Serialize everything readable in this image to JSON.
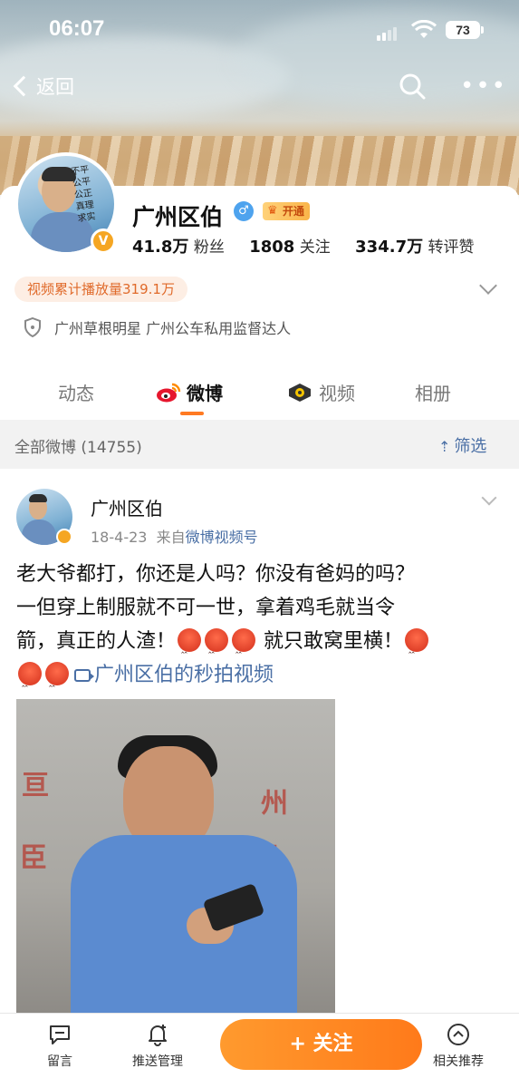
{
  "status": {
    "time": "06:07",
    "battery": "73"
  },
  "nav": {
    "back_label": "返回"
  },
  "profile": {
    "name": "广州区伯",
    "badge": "开通",
    "avatar_sign": "不平\n公平\n公正\n真理\n求实",
    "fans_value": "41.8万",
    "fans_label": "粉丝",
    "follow_value": "1808",
    "follow_label": "关注",
    "likes_value": "334.7万",
    "likes_label": "转评赞",
    "video_plays": "视频累计播放量319.1万",
    "tags": "广州草根明星 广州公车私用监督达人"
  },
  "tabs": [
    {
      "label": "动态"
    },
    {
      "label": "微博"
    },
    {
      "label": "视频"
    },
    {
      "label": "相册"
    }
  ],
  "filter": {
    "title": "全部微博 (14755)",
    "button": "筛选"
  },
  "post": {
    "author": "广州区伯",
    "date": "18-4-23",
    "from_prefix": "来自",
    "source": "微博视频号",
    "text_line1": "老大爷都打，你还是人吗？你没有爸妈的吗？",
    "text_line2": "一但穿上制服就不可一世，拿着鸡毛就当令",
    "text_line3a": "箭，真正的人渣！",
    "text_line3b": " 就只敢窝里横！",
    "video_link": "广州区伯的秒拍视频"
  },
  "bottom": {
    "comment": "留言",
    "push": "推送管理",
    "follow": "+ 关注",
    "recommend": "相关推荐"
  },
  "colors": {
    "accent": "#ff7a22",
    "link": "#4a6fa5",
    "badge_orange": "#f5a623"
  }
}
